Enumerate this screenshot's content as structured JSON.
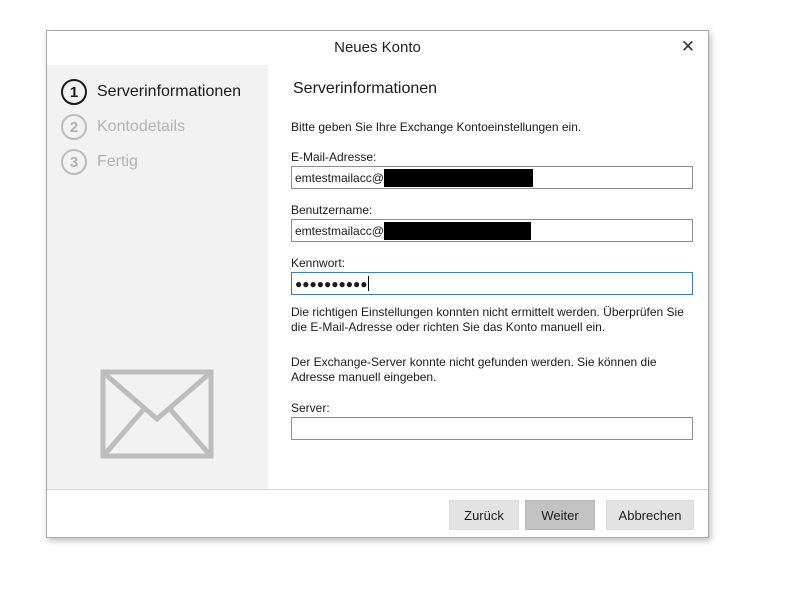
{
  "window": {
    "title": "Neues Konto",
    "close_symbol": "✕"
  },
  "steps": [
    {
      "number": "1",
      "label": "Serverinformationen",
      "active": true
    },
    {
      "number": "2",
      "label": "Kontodetails",
      "active": false
    },
    {
      "number": "3",
      "label": "Fertig",
      "active": false
    }
  ],
  "sidebar": {
    "icon": "mail-envelope-icon",
    "icon_color": "#bdbdbd"
  },
  "main": {
    "heading": "Serverinformationen",
    "intro": "Bitte geben Sie Ihre Exchange Kontoeinstellungen ein.",
    "email": {
      "label": "E-Mail-Adresse:",
      "value_prefix": "emtestmailacc@"
    },
    "username": {
      "label": "Benutzername:",
      "value_prefix": "emtestmailacc@"
    },
    "password": {
      "label": "Kennwort:",
      "masked_value": "●●●●●●●●●●"
    },
    "error_message": "Die richtigen Einstellungen konnten nicht ermittelt werden. Überprüfen Sie die E-Mail-Adresse oder richten Sie das Konto manuell ein.",
    "server_message": "Der Exchange-Server konnte nicht gefunden werden. Sie können die Adresse manuell eingeben.",
    "server": {
      "label": "Server:",
      "value": ""
    }
  },
  "footer": {
    "back_label": "Zurück",
    "next_label": "Weiter",
    "cancel_label": "Abbrechen"
  },
  "colors": {
    "sidebar_bg": "#f2f2f2",
    "active_step": "#1a1a1a",
    "inactive_step": "#b3b3b3",
    "focus_border": "#3c7fb1",
    "primary_button": "#c2c2c2"
  }
}
